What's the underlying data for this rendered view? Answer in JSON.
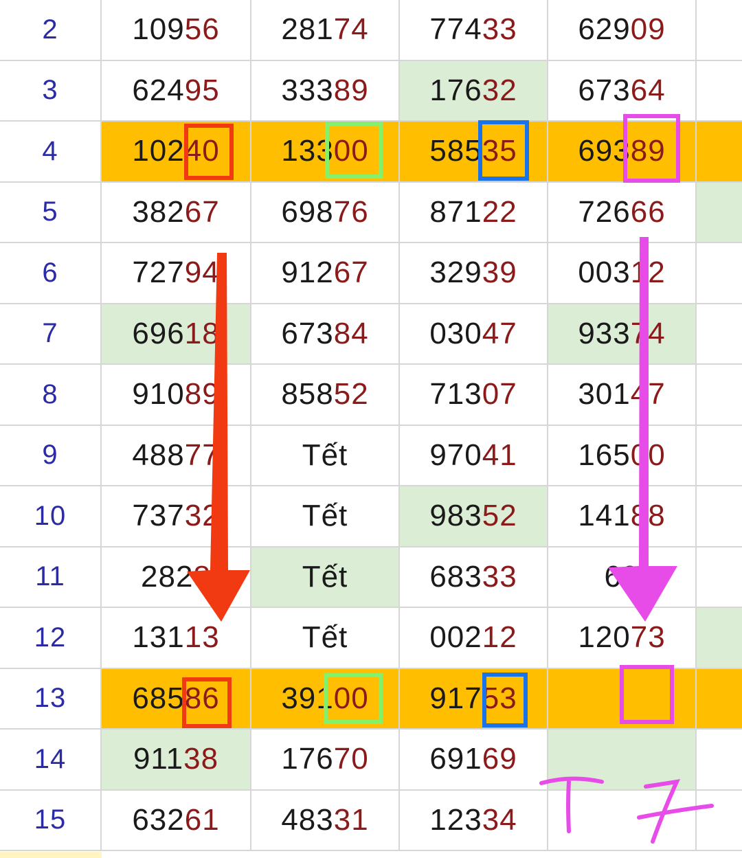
{
  "rows": [
    {
      "num": "2",
      "cells": [
        {
          "head": "109",
          "tail": "56"
        },
        {
          "head": "281",
          "tail": "74"
        },
        {
          "head": "774",
          "tail": "33"
        },
        {
          "head": "629",
          "tail": "09"
        }
      ],
      "green": [],
      "highlight": false
    },
    {
      "num": "3",
      "cells": [
        {
          "head": "624",
          "tail": "95"
        },
        {
          "head": "333",
          "tail": "89"
        },
        {
          "head": "176",
          "tail": "32"
        },
        {
          "head": "673",
          "tail": "64"
        }
      ],
      "green": [
        2
      ],
      "highlight": false
    },
    {
      "num": "4",
      "cells": [
        {
          "head": "102",
          "tail": "40"
        },
        {
          "head": "133",
          "tail": "00"
        },
        {
          "head": "585",
          "tail": "35"
        },
        {
          "head": "693",
          "tail": "89"
        }
      ],
      "green": [],
      "highlight": true
    },
    {
      "num": "5",
      "cells": [
        {
          "head": "382",
          "tail": "67"
        },
        {
          "head": "698",
          "tail": "76"
        },
        {
          "head": "871",
          "tail": "22"
        },
        {
          "head": "726",
          "tail": "66"
        }
      ],
      "green": [
        4
      ],
      "highlight": false
    },
    {
      "num": "6",
      "cells": [
        {
          "head": "727",
          "tail": "94"
        },
        {
          "head": "912",
          "tail": "67"
        },
        {
          "head": "329",
          "tail": "39"
        },
        {
          "head": "003",
          "tail": "12"
        }
      ],
      "green": [],
      "highlight": false
    },
    {
      "num": "7",
      "cells": [
        {
          "head": "696",
          "tail": "18"
        },
        {
          "head": "673",
          "tail": "84"
        },
        {
          "head": "030",
          "tail": "47"
        },
        {
          "head": "933",
          "tail": "74"
        }
      ],
      "green": [
        0,
        3
      ],
      "highlight": false
    },
    {
      "num": "8",
      "cells": [
        {
          "head": "910",
          "tail": "89"
        },
        {
          "head": "858",
          "tail": "52"
        },
        {
          "head": "713",
          "tail": "07"
        },
        {
          "head": "301",
          "tail": "47"
        }
      ],
      "green": [],
      "highlight": false
    },
    {
      "num": "9",
      "cells": [
        {
          "head": "488",
          "tail": "77"
        },
        {
          "head": "Tết",
          "tail": ""
        },
        {
          "head": "970",
          "tail": "41"
        },
        {
          "head": "165",
          "tail": "00"
        }
      ],
      "green": [],
      "highlight": false
    },
    {
      "num": "10",
      "cells": [
        {
          "head": "737",
          "tail": "32"
        },
        {
          "head": "Tết",
          "tail": ""
        },
        {
          "head": "983",
          "tail": "52"
        },
        {
          "head": "141",
          "tail": "88"
        }
      ],
      "green": [
        2
      ],
      "highlight": false
    },
    {
      "num": "11",
      "cells": [
        {
          "head": "282",
          "tail": "8"
        },
        {
          "head": "Tết",
          "tail": ""
        },
        {
          "head": "683",
          "tail": "33"
        },
        {
          "head": "69",
          "tail": ""
        }
      ],
      "green": [
        1
      ],
      "highlight": false
    },
    {
      "num": "12",
      "cells": [
        {
          "head": "131",
          "tail": "13"
        },
        {
          "head": "Tết",
          "tail": ""
        },
        {
          "head": "002",
          "tail": "12"
        },
        {
          "head": "120",
          "tail": "73"
        }
      ],
      "green": [
        4
      ],
      "highlight": false
    },
    {
      "num": "13",
      "cells": [
        {
          "head": "685",
          "tail": "86"
        },
        {
          "head": "391",
          "tail": "00"
        },
        {
          "head": "917",
          "tail": "53"
        },
        {
          "head": "",
          "tail": ""
        }
      ],
      "green": [],
      "highlight": true
    },
    {
      "num": "14",
      "cells": [
        {
          "head": "911",
          "tail": "38"
        },
        {
          "head": "176",
          "tail": "70"
        },
        {
          "head": "691",
          "tail": "69"
        },
        {
          "head": "",
          "tail": ""
        }
      ],
      "green": [
        0,
        3
      ],
      "highlight": false
    },
    {
      "num": "15",
      "cells": [
        {
          "head": "632",
          "tail": "61"
        },
        {
          "head": "483",
          "tail": "31"
        },
        {
          "head": "123",
          "tail": "34"
        },
        {
          "head": "",
          "tail": ""
        }
      ],
      "green": [],
      "highlight": false
    }
  ],
  "annotation": {
    "handwritten_text": "T 7"
  },
  "colors": {
    "highlight_row": "#ffbf00",
    "green_cell": "#dcedd6",
    "red_marker": "#f23a12",
    "green_marker": "#86f06a",
    "blue_marker": "#1a73e8",
    "pink_marker": "#e84ce8",
    "row_number": "#2b2ba6",
    "tail_digits": "#8b1a1a"
  }
}
